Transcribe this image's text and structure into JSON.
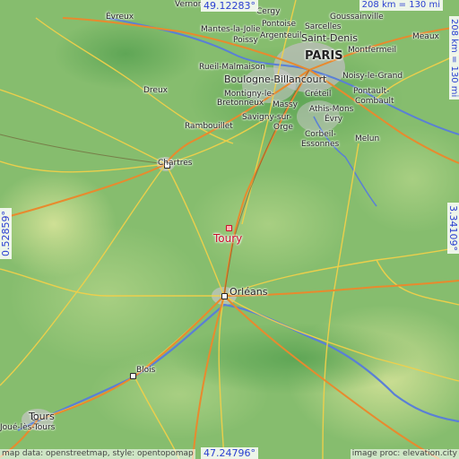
{
  "coords": {
    "top_lat": "49.12283°",
    "bottom_lat": "47.24796°",
    "left_lon": "0.52859°",
    "right_lon": "3.34109°"
  },
  "scale": {
    "top": "208 km = 130 mi",
    "right": "208 km = 130 mi"
  },
  "highlight_town": "Toury",
  "cities": {
    "vernon": "Vernon",
    "evreux": "Évreux",
    "cergy": "Cergy",
    "pontoise": "Pontoise",
    "goussainville": "Goussainville",
    "sarcelles": "Sarcelles",
    "mantes": "Mantes-la-Jolie",
    "poissy": "Poissy",
    "argenteuil": "Argenteuil",
    "saint_denis": "Saint-Denis",
    "meaux": "Meaux",
    "montfermeil": "Montfermeil",
    "paris": "PARIS",
    "rueil": "Rueil-Malmaison",
    "noisy": "Noisy-le-Grand",
    "boulogne": "Boulogne-Billancourt",
    "dreux": "Dreux",
    "montigny": "Montigny-le-",
    "bretonneux": "Bretonneux",
    "creteil": "Créteil",
    "pontault": "Pontault-",
    "combault": "Combault",
    "massy": "Massy",
    "athis": "Athis-Mons",
    "savigny": "Savigny-sur-",
    "orge": "Orge",
    "evry": "Évry",
    "rambouillet": "Rambouillet",
    "corbeil": "Corbeil-",
    "essonnes": "Essonnes",
    "melun": "Melun",
    "chartres": "Chartres",
    "orleans": "Orléans",
    "blois": "Blois",
    "tours": "Tours",
    "joue": "Joué-lès-Tours"
  },
  "attribution": {
    "left": "map data: openstreetmap, style: opentopomap",
    "right": "image proc: elevation.city"
  },
  "colors": {
    "lowland": "#7fb86a",
    "highland": "#c9dc8a",
    "road_major": "#e88a2e",
    "road_minor": "#f1d04a",
    "river": "#5a7fd6",
    "urban": "#c8c8c8",
    "coord_text": "#2a3fd1",
    "highlight": "#c8102e"
  }
}
